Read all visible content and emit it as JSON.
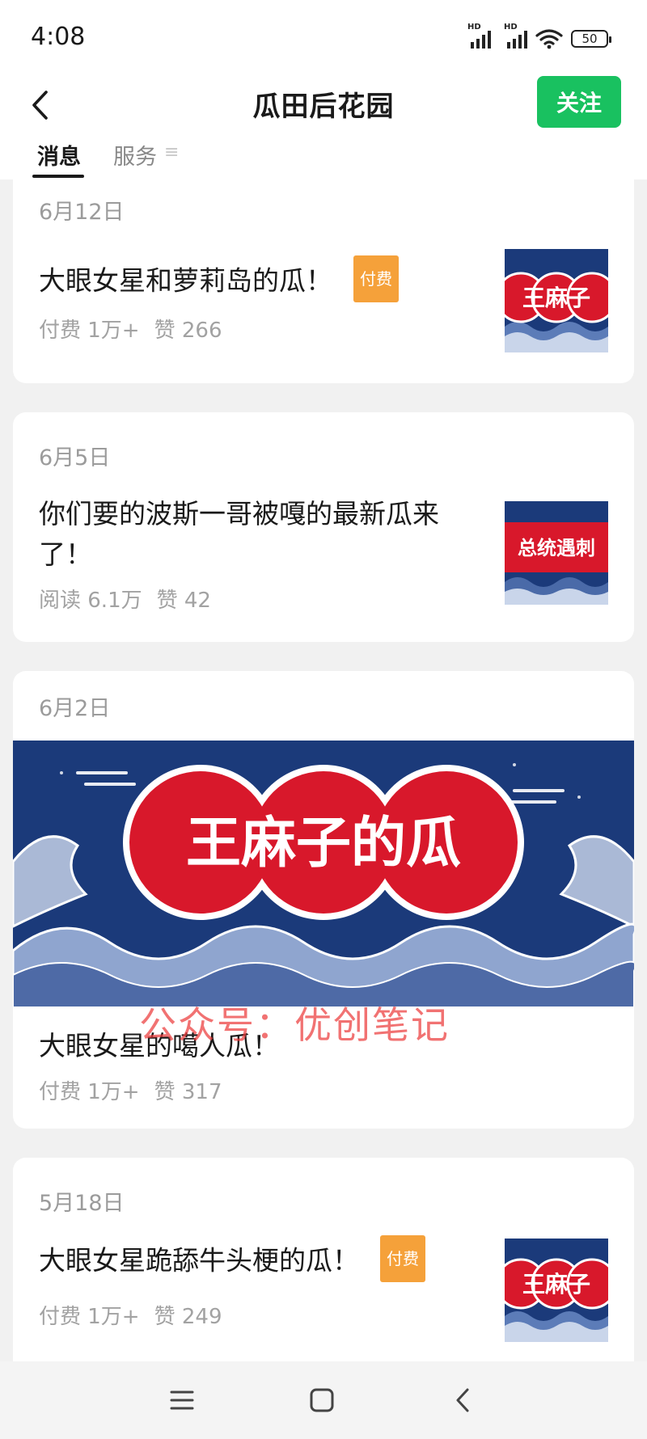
{
  "status_bar": {
    "time": "4:08",
    "battery": "50",
    "hd1": "HD",
    "hd2": "HD"
  },
  "header": {
    "title": "瓜田后花园",
    "follow_label": "关注"
  },
  "tabs": [
    {
      "label": "消息"
    },
    {
      "label": "服务"
    }
  ],
  "articles": [
    {
      "date": "6月12日",
      "title": "大眼女星和萝莉岛的瓜！",
      "badge": "付费",
      "stat1": "付费 1万+",
      "stat2": "赞 266",
      "thumb_text": "王麻子"
    },
    {
      "date": "6月5日",
      "title_line1": "你们要的波斯一哥被嘎的最新瓜来",
      "title_line2": "了！",
      "stat1": "阅读 6.1万",
      "stat2": "赞 42",
      "thumb_text": "总统遇刺"
    },
    {
      "date": "6月2日",
      "banner_text": "王麻子的瓜",
      "title": "大眼女星的噶人瓜！",
      "stat1": "付费 1万+",
      "stat2": "赞 317"
    },
    {
      "date": "5月18日",
      "title": "大眼女星跪舔牛头梗的瓜！",
      "badge": "付费",
      "stat1": "付费 1万+",
      "stat2": "赞 249",
      "thumb_text": "王麻子"
    }
  ],
  "watermark": "公众号：优创笔记",
  "colors": {
    "accent_green": "#19c160",
    "badge_orange": "#f5a13a",
    "banner_red": "#d8182b",
    "banner_navy": "#1b3a7a"
  },
  "nav_icons": [
    "menu-icon",
    "home-icon",
    "back-icon"
  ]
}
